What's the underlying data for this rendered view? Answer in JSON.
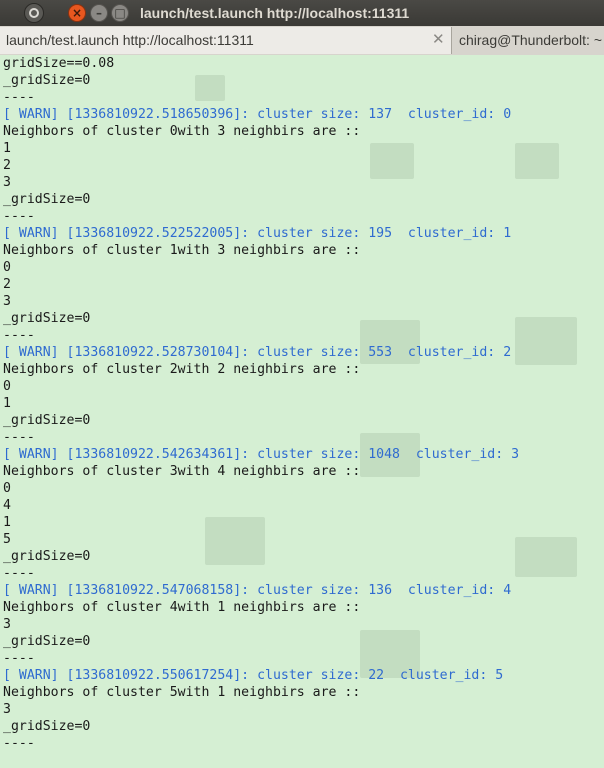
{
  "window": {
    "title": "launch/test.launch http://localhost:11311"
  },
  "tabs": [
    {
      "label": "launch/test.launch http://localhost:11311",
      "active": true
    },
    {
      "label": "chirag@Thunderbolt: ~",
      "active": false
    }
  ],
  "tab_close_icon": "✕",
  "colors": {
    "terminal_bg": "#d5efd3",
    "text": "#1a1a1a",
    "warn": "#2f6bd0"
  },
  "terminal": {
    "lines": [
      {
        "text": "gridSize==0.08",
        "type": "normal"
      },
      {
        "text": "_gridSize=0",
        "type": "normal"
      },
      {
        "text": "----",
        "type": "normal"
      },
      {
        "text": "[ WARN] [1336810922.518650396]: cluster size: 137  cluster_id: 0",
        "type": "warn"
      },
      {
        "text": "Neighbors of cluster 0with 3 neighbirs are ::",
        "type": "normal"
      },
      {
        "text": "1",
        "type": "normal"
      },
      {
        "text": "2",
        "type": "normal"
      },
      {
        "text": "3",
        "type": "normal"
      },
      {
        "text": "_gridSize=0",
        "type": "normal"
      },
      {
        "text": "----",
        "type": "normal"
      },
      {
        "text": "[ WARN] [1336810922.522522005]: cluster size: 195  cluster_id: 1",
        "type": "warn"
      },
      {
        "text": "Neighbors of cluster 1with 3 neighbirs are ::",
        "type": "normal"
      },
      {
        "text": "0",
        "type": "normal"
      },
      {
        "text": "2",
        "type": "normal"
      },
      {
        "text": "3",
        "type": "normal"
      },
      {
        "text": "_gridSize=0",
        "type": "normal"
      },
      {
        "text": "----",
        "type": "normal"
      },
      {
        "text": "[ WARN] [1336810922.528730104]: cluster size: 553  cluster_id: 2",
        "type": "warn"
      },
      {
        "text": "Neighbors of cluster 2with 2 neighbirs are ::",
        "type": "normal"
      },
      {
        "text": "0",
        "type": "normal"
      },
      {
        "text": "1",
        "type": "normal"
      },
      {
        "text": "_gridSize=0",
        "type": "normal"
      },
      {
        "text": "----",
        "type": "normal"
      },
      {
        "text": "[ WARN] [1336810922.542634361]: cluster size: 1048  cluster_id: 3",
        "type": "warn"
      },
      {
        "text": "Neighbors of cluster 3with 4 neighbirs are ::",
        "type": "normal"
      },
      {
        "text": "0",
        "type": "normal"
      },
      {
        "text": "4",
        "type": "normal"
      },
      {
        "text": "1",
        "type": "normal"
      },
      {
        "text": "5",
        "type": "normal"
      },
      {
        "text": "_gridSize=0",
        "type": "normal"
      },
      {
        "text": "----",
        "type": "normal"
      },
      {
        "text": "[ WARN] [1336810922.547068158]: cluster size: 136  cluster_id: 4",
        "type": "warn"
      },
      {
        "text": "Neighbors of cluster 4with 1 neighbirs are ::",
        "type": "normal"
      },
      {
        "text": "3",
        "type": "normal"
      },
      {
        "text": "_gridSize=0",
        "type": "normal"
      },
      {
        "text": "----",
        "type": "normal"
      },
      {
        "text": "[ WARN] [1336810922.550617254]: cluster size: 22  cluster_id: 5",
        "type": "warn"
      },
      {
        "text": "Neighbors of cluster 5with 1 neighbirs are ::",
        "type": "normal"
      },
      {
        "text": "3",
        "type": "normal"
      },
      {
        "text": "_gridSize=0",
        "type": "normal"
      },
      {
        "text": "----",
        "type": "normal"
      }
    ]
  }
}
